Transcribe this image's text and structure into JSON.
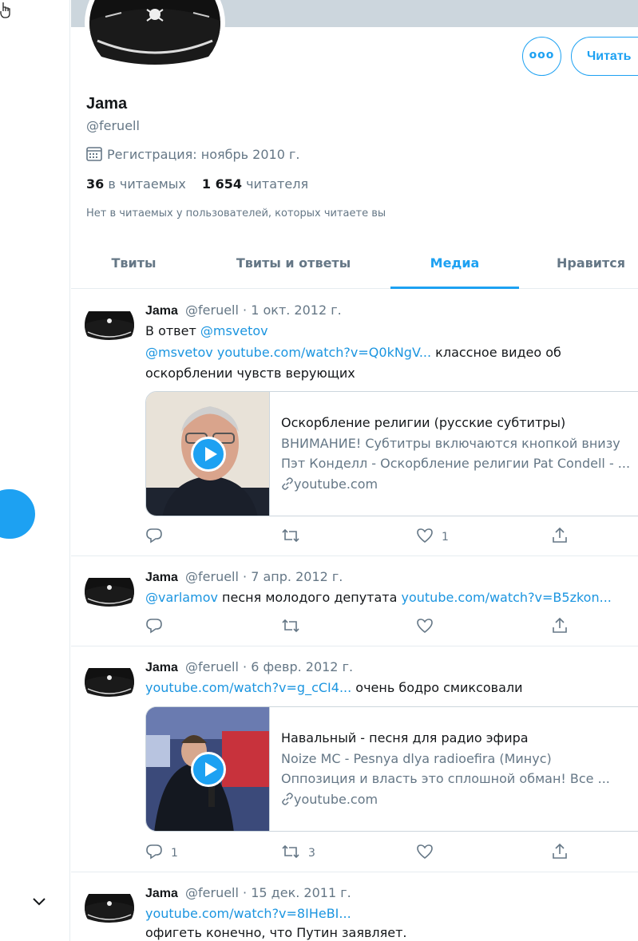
{
  "profile": {
    "name": "Jama",
    "handle": "@feruell",
    "joined": "Регистрация: ноябрь 2010 г.",
    "following_count": "36",
    "following_label": "в читаемых",
    "followers_count": "1 654",
    "followers_label": "читателя",
    "mutual_note": "Нет в читаемых у пользователей, которых читаете вы",
    "more_label": "ooo",
    "follow_label": "Читать"
  },
  "tabs": [
    {
      "label": "Твиты"
    },
    {
      "label": "Твиты и ответы"
    },
    {
      "label": "Медиа",
      "active": true
    },
    {
      "label": "Нравится"
    }
  ],
  "tweets": [
    {
      "name": "Jama",
      "handle": "@feruell",
      "date": "· 1 окт. 2012 г.",
      "reply_prefix": "В ответ",
      "reply_to": "@msvetov",
      "line1_mention": "@msvetov",
      "line1_link": "youtube.com/watch?v=Q0kNgV...",
      "line1_text": " классное видео об",
      "line2_text": "оскорблении чувств верующих",
      "card": {
        "title": "Оскорбление религии (русские субтитры)",
        "desc1": "ВНИМАНИЕ! Субтитры включаются кнопкой внизу",
        "desc2": "Пэт Конделл - Оскорбление религии Pat Condell - ...",
        "domain": "youtube.com"
      },
      "replies": "",
      "retweets": "",
      "likes": "1"
    },
    {
      "name": "Jama",
      "handle": "@feruell",
      "date": "· 7 апр. 2012 г.",
      "mention": "@varlamov",
      "text": " песня молодого депутата ",
      "link": "youtube.com/watch?v=B5zkon...",
      "replies": "",
      "retweets": "",
      "likes": ""
    },
    {
      "name": "Jama",
      "handle": "@feruell",
      "date": "· 6 февр. 2012 г.",
      "link": "youtube.com/watch?v=g_cCI4...",
      "text": " очень бодро смиксовали",
      "card": {
        "title": "Навальный - песня для радио эфира",
        "desc1": "Noize MC - Pesnya dlya radioefira (Минус)",
        "desc2": "Оппозиция и власть это сплошной обман! Все ...",
        "domain": "youtube.com"
      },
      "replies": "1",
      "retweets": "3",
      "likes": ""
    },
    {
      "name": "Jama",
      "handle": "@feruell",
      "date": "· 15 дек. 2011 г.",
      "link": "youtube.com/watch?v=8IHeBI...",
      "text": "офигеть конечно, что Путин заявляет."
    }
  ],
  "colors": {
    "accent": "#1da1f2",
    "link": "#1b95e0",
    "muted": "#657786"
  },
  "icons": [
    "calendar-icon",
    "reply-icon",
    "retweet-icon",
    "like-icon",
    "share-icon",
    "play-icon",
    "link-icon",
    "chevron-down-icon",
    "cursor-hand-icon"
  ]
}
